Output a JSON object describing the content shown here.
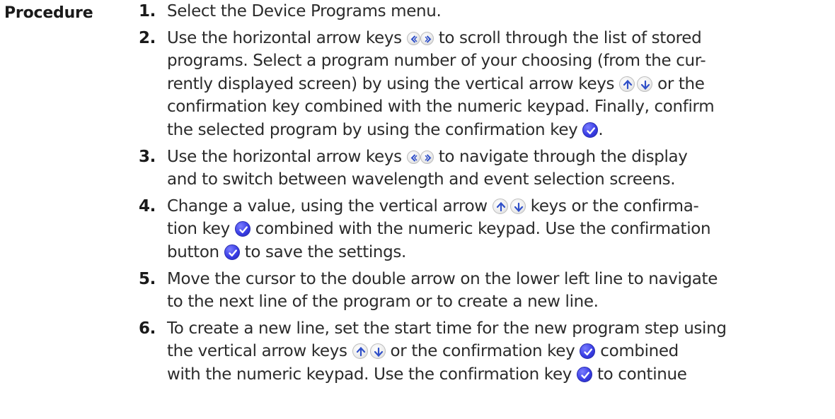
{
  "section_label": "Procedure",
  "steps": [
    {
      "number": "1.",
      "lines": [
        "Select the Device Programs menu."
      ]
    },
    {
      "number": "2.",
      "segments": {
        "a": "Use the horizontal arrow keys",
        "b": "to scroll through the list of stored",
        "c": "programs. Select a program number of your choosing (from the cur-",
        "d": "rently displayed screen) by using the vertical arrow keys",
        "e": "or the",
        "f": "confirmation key combined with the numeric keypad. Finally, confirm",
        "g": "the selected program by using the confirmation key",
        "h": "."
      }
    },
    {
      "number": "3.",
      "segments": {
        "a": "Use the horizontal arrow keys",
        "b": "to navigate through the display",
        "c": "and to switch between wavelength and event selection screens."
      }
    },
    {
      "number": "4.",
      "segments": {
        "a": "Change a value, using the vertical arrow",
        "b": "keys or the confirma-",
        "c": "tion key",
        "d": "combined with the numeric keypad. Use the confirmation",
        "e": "button",
        "f": "to save the settings."
      }
    },
    {
      "number": "5.",
      "lines": [
        "Move the cursor to the double arrow on the lower left line to navigate",
        "to the next line of the program or to create a new line."
      ]
    },
    {
      "number": "6.",
      "segments": {
        "a": "To create a new line, set the start time for the new program step using",
        "b": "the vertical arrow keys",
        "c": "or the confirmation key",
        "d": "combined",
        "e": "with the numeric keypad. Use the confirmation key",
        "f": "to continue"
      }
    }
  ],
  "icons": {
    "horizontal_arrow_left": "arrow-left-key-icon",
    "horizontal_arrow_right": "arrow-right-key-icon",
    "vertical_arrow_up": "arrow-up-key-icon",
    "vertical_arrow_down": "arrow-down-key-icon",
    "confirm": "confirm-check-key-icon"
  },
  "colors": {
    "confirm_key": "#3b3fe6",
    "arrow_glyph": "#2f4fc8",
    "text": "#2b2b2b"
  }
}
